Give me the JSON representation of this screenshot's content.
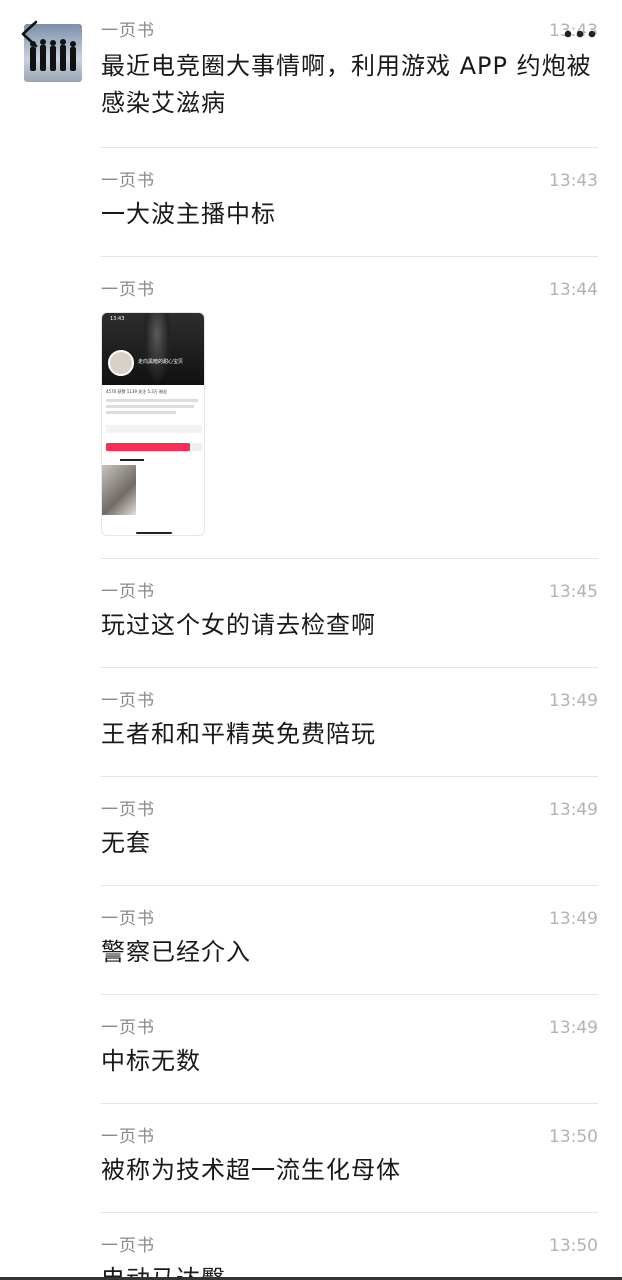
{
  "header": {
    "back_icon": "chevron-left-icon",
    "more_icon": "more-horizontal-icon"
  },
  "messages": [
    {
      "author": "一页书",
      "time": "13:43",
      "text": "最近电竞圈大事情啊，利用游戏 APP 约炮被感染艾滋病"
    },
    {
      "author": "一页书",
      "time": "13:43",
      "text": "一大波主播中标"
    },
    {
      "author": "一页书",
      "time": "13:44",
      "image": {
        "status_time": "13:43",
        "profile_name": "走向黑暗的甜心宝贝",
        "stats": "4570 获赞  1139 关注  5.3万 粉丝"
      }
    },
    {
      "author": "一页书",
      "time": "13:45",
      "text": "玩过这个女的请去检查啊"
    },
    {
      "author": "一页书",
      "time": "13:49",
      "text": "王者和和平精英免费陪玩"
    },
    {
      "author": "一页书",
      "time": "13:49",
      "text": "无套"
    },
    {
      "author": "一页书",
      "time": "13:49",
      "text": "警察已经介入"
    },
    {
      "author": "一页书",
      "time": "13:49",
      "text": "中标无数"
    },
    {
      "author": "一页书",
      "time": "13:50",
      "text": "被称为技术超一流生化母体"
    },
    {
      "author": "一页书",
      "time": "13:50",
      "text": "电动马达臀"
    }
  ]
}
